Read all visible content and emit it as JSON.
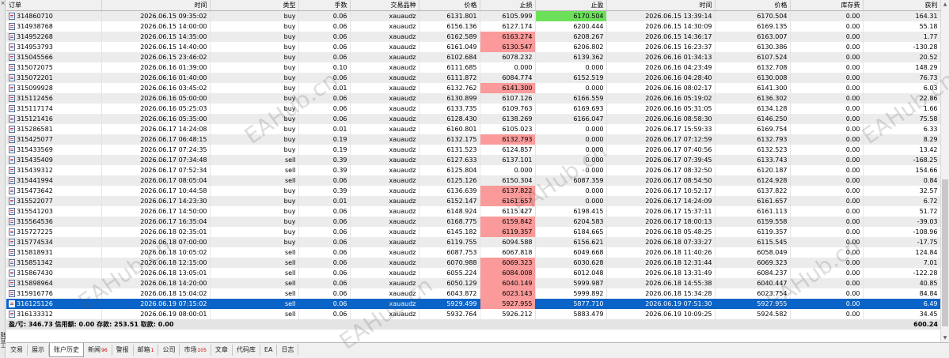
{
  "columns": [
    "订单",
    "时间",
    "类型",
    "手数",
    "交易品种",
    "价格",
    "止损",
    "止盈",
    "时间",
    "价格",
    "库存费",
    "获利"
  ],
  "rows": [
    {
      "order": "314860710",
      "open_time": "2026.06.15 09:35:02",
      "type": "buy",
      "lots": "0.06",
      "symbol": "xauaudz",
      "open_price": "6131.801",
      "sl": "6105.999",
      "tp": "6170.504",
      "close_time": "2026.06.15 13:39:14",
      "close_price": "6170.504",
      "swap": "0.00",
      "profit": "164.31",
      "hl": "tp-green"
    },
    {
      "order": "314938768",
      "open_time": "2026.06.15 14:00:00",
      "type": "buy",
      "lots": "0.06",
      "symbol": "xauaudz",
      "open_price": "6156.136",
      "sl": "6127.174",
      "tp": "6200.444",
      "close_time": "2026.06.15 14:30:09",
      "close_price": "6169.135",
      "swap": "0.00",
      "profit": "55.18",
      "hl": ""
    },
    {
      "order": "314952268",
      "open_time": "2026.06.15 14:35:00",
      "type": "buy",
      "lots": "0.06",
      "symbol": "xauaudz",
      "open_price": "6162.589",
      "sl": "6163.274",
      "tp": "6208.267",
      "close_time": "2026.06.15 14:36:17",
      "close_price": "6163.007",
      "swap": "0.00",
      "profit": "1.77",
      "hl": "sl-red"
    },
    {
      "order": "314953793",
      "open_time": "2026.06.15 14:40:00",
      "type": "buy",
      "lots": "0.06",
      "symbol": "xauaudz",
      "open_price": "6161.049",
      "sl": "6130.547",
      "tp": "6206.802",
      "close_time": "2026.06.15 16:23:37",
      "close_price": "6130.386",
      "swap": "0.00",
      "profit": "-130.28",
      "hl": "sl-red"
    },
    {
      "order": "315045566",
      "open_time": "2026.06.15 23:46:02",
      "type": "buy",
      "lots": "0.06",
      "symbol": "xauaudz",
      "open_price": "6102.684",
      "sl": "6078.232",
      "tp": "6139.362",
      "close_time": "2026.06.16 01:34:13",
      "close_price": "6107.524",
      "swap": "0.00",
      "profit": "20.52",
      "hl": ""
    },
    {
      "order": "315072075",
      "open_time": "2026.06.16 01:39:00",
      "type": "buy",
      "lots": "0.10",
      "symbol": "xauaudz",
      "open_price": "6111.685",
      "sl": "0.000",
      "tp": "0.000",
      "close_time": "2026.06.16 04:23:49",
      "close_price": "6132.708",
      "swap": "0.00",
      "profit": "148.29",
      "hl": ""
    },
    {
      "order": "315072201",
      "open_time": "2026.06.16 01:40:00",
      "type": "buy",
      "lots": "0.06",
      "symbol": "xauaudz",
      "open_price": "6111.872",
      "sl": "6084.774",
      "tp": "6152.519",
      "close_time": "2026.06.16 04:28:40",
      "close_price": "6130.008",
      "swap": "0.00",
      "profit": "76.73",
      "hl": ""
    },
    {
      "order": "315099928",
      "open_time": "2026.06.16 03:45:02",
      "type": "buy",
      "lots": "0.01",
      "symbol": "xauaudz",
      "open_price": "6132.762",
      "sl": "6141.300",
      "tp": "0.000",
      "close_time": "2026.06.16 08:02:17",
      "close_price": "6141.300",
      "swap": "0.00",
      "profit": "6.03",
      "hl": "sl-red"
    },
    {
      "order": "315112456",
      "open_time": "2026.06.16 05:00:00",
      "type": "buy",
      "lots": "0.06",
      "symbol": "xauaudz",
      "open_price": "6130.899",
      "sl": "6107.126",
      "tp": "6166.559",
      "close_time": "2026.06.16 05:19:02",
      "close_price": "6136.302",
      "swap": "0.00",
      "profit": "22.86",
      "hl": ""
    },
    {
      "order": "315117174",
      "open_time": "2026.06.16 05:25:03",
      "type": "buy",
      "lots": "0.06",
      "symbol": "xauaudz",
      "open_price": "6133.735",
      "sl": "6109.763",
      "tp": "6169.693",
      "close_time": "2026.06.16 05:31:05",
      "close_price": "6134.128",
      "swap": "0.00",
      "profit": "1.66",
      "hl": ""
    },
    {
      "order": "315121416",
      "open_time": "2026.06.16 05:35:00",
      "type": "buy",
      "lots": "0.06",
      "symbol": "xauaudz",
      "open_price": "6128.430",
      "sl": "6138.269",
      "tp": "6166.047",
      "close_time": "2026.06.16 08:58:30",
      "close_price": "6146.250",
      "swap": "0.00",
      "profit": "75.58",
      "hl": ""
    },
    {
      "order": "315286581",
      "open_time": "2026.06.17 14:24:08",
      "type": "buy",
      "lots": "0.01",
      "symbol": "xauaudz",
      "open_price": "6160.801",
      "sl": "6105.023",
      "tp": "0.000",
      "close_time": "2026.06.17 15:59:33",
      "close_price": "6169.754",
      "swap": "0.00",
      "profit": "6.33",
      "hl": ""
    },
    {
      "order": "315425077",
      "open_time": "2026.06.17 06:48:15",
      "type": "buy",
      "lots": "0.19",
      "symbol": "xauaudz",
      "open_price": "6132.175",
      "sl": "6132.793",
      "tp": "0.000",
      "close_time": "2026.06.17 07:12:59",
      "close_price": "6132.793",
      "swap": "0.00",
      "profit": "8.29",
      "hl": "sl-red"
    },
    {
      "order": "315433569",
      "open_time": "2026.06.17 07:24:35",
      "type": "buy",
      "lots": "0.19",
      "symbol": "xauaudz",
      "open_price": "6131.523",
      "sl": "6124.857",
      "tp": "0.000",
      "close_time": "2026.06.17 07:40:56",
      "close_price": "6132.523",
      "swap": "0.00",
      "profit": "13.42",
      "hl": ""
    },
    {
      "order": "315435409",
      "open_time": "2026.06.17 07:34:48",
      "type": "sell",
      "lots": "0.39",
      "symbol": "xauaudz",
      "open_price": "6127.633",
      "sl": "6137.101",
      "tp": "0.000",
      "close_time": "2026.06.17 07:39:45",
      "close_price": "6133.743",
      "swap": "0.00",
      "profit": "-168.25",
      "hl": ""
    },
    {
      "order": "315439312",
      "open_time": "2026.06.17 07:52:34",
      "type": "sell",
      "lots": "0.39",
      "symbol": "xauaudz",
      "open_price": "6125.804",
      "sl": "0.000",
      "tp": "0.000",
      "close_time": "2026.06.17 08:32:50",
      "close_price": "6120.187",
      "swap": "0.00",
      "profit": "154.66",
      "hl": ""
    },
    {
      "order": "315441994",
      "open_time": "2026.06.17 08:05:04",
      "type": "sell",
      "lots": "0.06",
      "symbol": "xauaudz",
      "open_price": "6125.126",
      "sl": "6150.304",
      "tp": "6087.359",
      "close_time": "2026.06.17 08:54:50",
      "close_price": "6124.928",
      "swap": "0.00",
      "profit": "0.84",
      "hl": ""
    },
    {
      "order": "315473642",
      "open_time": "2026.06.17 10:44:58",
      "type": "buy",
      "lots": "0.39",
      "symbol": "xauaudz",
      "open_price": "6136.639",
      "sl": "6137.822",
      "tp": "0.000",
      "close_time": "2026.06.17 10:52:17",
      "close_price": "6137.822",
      "swap": "0.00",
      "profit": "32.57",
      "hl": "sl-red"
    },
    {
      "order": "315522077",
      "open_time": "2026.06.17 14:23:30",
      "type": "buy",
      "lots": "0.01",
      "symbol": "xauaudz",
      "open_price": "6152.147",
      "sl": "6161.657",
      "tp": "0.000",
      "close_time": "2026.06.17 14:24:09",
      "close_price": "6161.657",
      "swap": "0.00",
      "profit": "6.72",
      "hl": "sl-red"
    },
    {
      "order": "315541203",
      "open_time": "2026.06.17 14:50:00",
      "type": "buy",
      "lots": "0.06",
      "symbol": "xauaudz",
      "open_price": "6148.924",
      "sl": "6115.427",
      "tp": "6198.415",
      "close_time": "2026.06.17 15:37:11",
      "close_price": "6161.113",
      "swap": "0.00",
      "profit": "51.72",
      "hl": ""
    },
    {
      "order": "315564536",
      "open_time": "2026.06.17 16:35:04",
      "type": "buy",
      "lots": "0.06",
      "symbol": "xauaudz",
      "open_price": "6168.775",
      "sl": "6159.842",
      "tp": "6204.583",
      "close_time": "2026.06.17 18:00:13",
      "close_price": "6159.558",
      "swap": "0.00",
      "profit": "-39.03",
      "hl": "sl-red"
    },
    {
      "order": "315727225",
      "open_time": "2026.06.18 02:35:01",
      "type": "buy",
      "lots": "0.06",
      "symbol": "xauaudz",
      "open_price": "6145.182",
      "sl": "6119.357",
      "tp": "6184.665",
      "close_time": "2026.06.18 05:48:25",
      "close_price": "6119.357",
      "swap": "0.00",
      "profit": "-108.96",
      "hl": "sl-red"
    },
    {
      "order": "315774534",
      "open_time": "2026.06.18 07:00:00",
      "type": "buy",
      "lots": "0.06",
      "symbol": "xauaudz",
      "open_price": "6119.755",
      "sl": "6094.588",
      "tp": "6156.621",
      "close_time": "2026.06.18 07:33:27",
      "close_price": "6115.545",
      "swap": "0.00",
      "profit": "-17.75",
      "hl": ""
    },
    {
      "order": "315818931",
      "open_time": "2026.06.18 10:05:02",
      "type": "sell",
      "lots": "0.06",
      "symbol": "xauaudz",
      "open_price": "6087.753",
      "sl": "6067.818",
      "tp": "6049.668",
      "close_time": "2026.06.18 11:40:26",
      "close_price": "6058.049",
      "swap": "0.00",
      "profit": "124.84",
      "hl": ""
    },
    {
      "order": "315851342",
      "open_time": "2026.06.18 12:15:00",
      "type": "sell",
      "lots": "0.06",
      "symbol": "xauaudz",
      "open_price": "6070.988",
      "sl": "6069.323",
      "tp": "6030.628",
      "close_time": "2026.06.18 12:31:44",
      "close_price": "6069.323",
      "swap": "0.00",
      "profit": "7.01",
      "hl": "sl-red"
    },
    {
      "order": "315867430",
      "open_time": "2026.06.18 13:05:01",
      "type": "sell",
      "lots": "0.06",
      "symbol": "xauaudz",
      "open_price": "6055.224",
      "sl": "6084.008",
      "tp": "6012.048",
      "close_time": "2026.06.18 13:31:49",
      "close_price": "6084.237",
      "swap": "0.00",
      "profit": "-122.28",
      "hl": "sl-red"
    },
    {
      "order": "315898964",
      "open_time": "2026.06.18 14:20:00",
      "type": "sell",
      "lots": "0.06",
      "symbol": "xauaudz",
      "open_price": "6050.129",
      "sl": "6040.149",
      "tp": "5999.987",
      "close_time": "2026.06.18 14:55:38",
      "close_price": "6040.447",
      "swap": "0.00",
      "profit": "40.85",
      "hl": "sl-red"
    },
    {
      "order": "315916776",
      "open_time": "2026.06.18 15:04:02",
      "type": "sell",
      "lots": "0.06",
      "symbol": "xauaudz",
      "open_price": "6043.872",
      "sl": "6023.143",
      "tp": "5999.892",
      "close_time": "2026.06.18 15:34:28",
      "close_price": "6023.754",
      "swap": "0.00",
      "profit": "84.84",
      "hl": "sl-red"
    },
    {
      "order": "316125126",
      "open_time": "2026.06.19 07:15:02",
      "type": "sell",
      "lots": "0.06",
      "symbol": "xauaudz",
      "open_price": "5929.499",
      "sl": "5927.955",
      "tp": "5877.710",
      "close_time": "2026.06.19 07:51:30",
      "close_price": "5927.955",
      "swap": "0.00",
      "profit": "6.49",
      "hl": "sl-red",
      "selected": true
    },
    {
      "order": "316133312",
      "open_time": "2026.06.19 08:00:01",
      "type": "sell",
      "lots": "0.06",
      "symbol": "xauaudz",
      "open_price": "5932.764",
      "sl": "5926.212",
      "tp": "5883.479",
      "close_time": "2026.06.19 10:09:25",
      "close_price": "5924.582",
      "swap": "0.00",
      "profit": "34.45",
      "hl": ""
    }
  ],
  "summary": {
    "text": "盈/亏: 346.73  信用额: 0.00  存款: 253.51  取款: 0.00",
    "total": "600.24"
  },
  "sidebar": {
    "close": "×",
    "label": "工具箱"
  },
  "tabs": [
    {
      "label": "交易",
      "badge": ""
    },
    {
      "label": "展示",
      "badge": ""
    },
    {
      "label": "账户历史",
      "badge": "",
      "active": true
    },
    {
      "label": "新闻",
      "badge": "96"
    },
    {
      "label": "警报",
      "badge": ""
    },
    {
      "label": "邮箱",
      "badge": "1"
    },
    {
      "label": "公司",
      "badge": ""
    },
    {
      "label": "市场",
      "badge": "105"
    },
    {
      "label": "文章",
      "badge": ""
    },
    {
      "label": "代码库",
      "badge": ""
    },
    {
      "label": "EA",
      "badge": ""
    },
    {
      "label": "日志",
      "badge": ""
    }
  ],
  "watermark": "EAHub.cn",
  "colors": {
    "selected_row": "#0a63c6",
    "sl_hit": "#fa9a9a",
    "tp_hit": "#6de05a",
    "alt_row": "#ececec"
  }
}
